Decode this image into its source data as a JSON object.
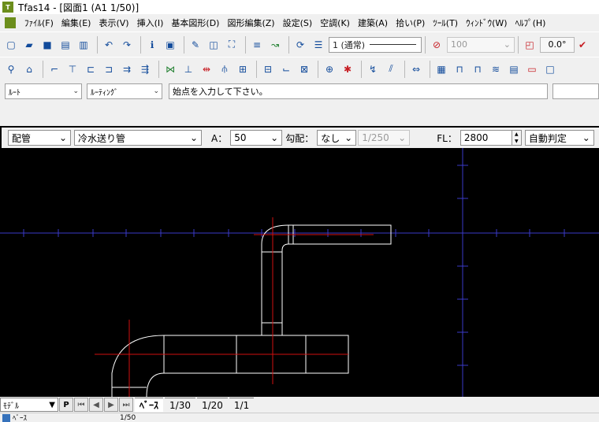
{
  "window": {
    "title": "Tfas14 - [図面1 (A1 1/50)]",
    "app_icon": "T",
    "colors": {
      "accent": "#6c8e1c",
      "canvas": "#000000"
    }
  },
  "menu": [
    "ﾌｧｲﾙ(F)",
    "編集(E)",
    "表示(V)",
    "挿入(I)",
    "基本図形(D)",
    "図形編集(Z)",
    "設定(S)",
    "空調(K)",
    "建築(A)",
    "拾い(P)",
    "ﾂｰﾙ(T)",
    "ｳｨﾝﾄﾞｳ(W)",
    "ﾍﾙﾌﾟ(H)"
  ],
  "toolbar1": {
    "icons": [
      "new-icon",
      "open-icon",
      "save-icon",
      "print-preview-icon",
      "print-icon",
      "undo-icon",
      "redo-icon",
      "info-icon",
      "property-icon",
      "pen-icon",
      "frame-icon",
      "fit-view-icon",
      "text-format-icon",
      "measure-icon",
      "refresh-icon",
      "layer-icon"
    ],
    "layer_value": "1 (通常)",
    "disabled_value": "100",
    "angle_value": "0.0°"
  },
  "cmdbar": {
    "route_value": "ﾙｰﾄ",
    "routing_value": "ﾙｰﾃｨﾝｸﾞ",
    "prompt": "始点を入力して下さい。"
  },
  "propbar": {
    "kind": "配管",
    "usage": "冷水送り管",
    "a_label": "A：",
    "a_value": "50",
    "slope_label": "勾配：",
    "slope_value": "なし",
    "ratio_value": "1/250",
    "fl_label": "FL：",
    "fl_value": "2800",
    "auto_value": "自動判定"
  },
  "bottom": {
    "model": "ﾓﾃﾞﾙ",
    "p_button": "P",
    "tabs": [
      "ﾍﾞｰｽ",
      "1/30",
      "1/20",
      "1/1"
    ]
  },
  "status": {
    "left": "ﾍﾞｰｽ",
    "scale": "1/50"
  }
}
